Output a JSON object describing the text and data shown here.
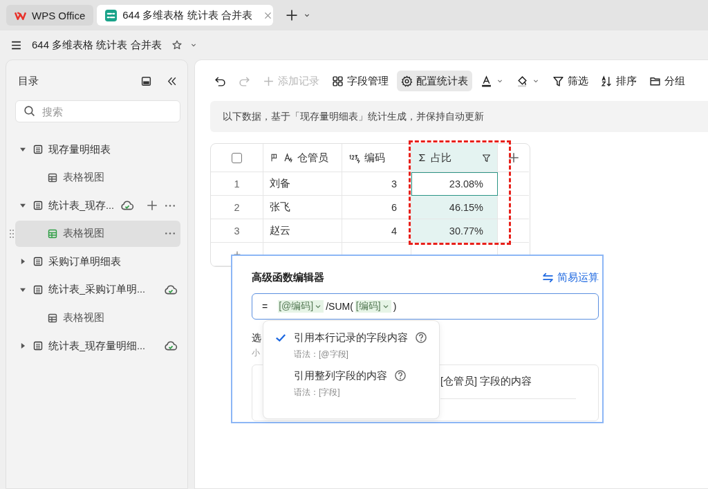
{
  "browser_tabs": [
    {
      "label": "WPS Office",
      "selected": false,
      "closable": false
    },
    {
      "label": "644 多维表格 统计表 合并表",
      "selected": true,
      "closable": true
    }
  ],
  "header": {
    "title": "644 多维表格 统计表 合并表",
    "starred": false
  },
  "sidebar": {
    "title": "目录",
    "search": {
      "placeholder": "搜索"
    },
    "items": [
      {
        "label": "现存量明细表",
        "kind": "table",
        "expanded": true,
        "synced": false,
        "selected": false,
        "actions_visible": false,
        "children": [
          {
            "label": "表格视图",
            "kind": "view",
            "selected": false,
            "actions_visible": false
          }
        ]
      },
      {
        "label": "统计表_现存...",
        "kind": "table",
        "expanded": true,
        "synced": true,
        "selected": false,
        "actions_visible": true,
        "children": [
          {
            "label": "表格视图",
            "kind": "view",
            "selected": true,
            "actions_visible": true
          }
        ]
      },
      {
        "label": "采购订单明细表",
        "kind": "table",
        "expanded": false,
        "synced": false,
        "selected": false,
        "actions_visible": false
      },
      {
        "label": "统计表_采购订单明...",
        "kind": "table",
        "expanded": true,
        "synced": true,
        "selected": false,
        "actions_visible": false,
        "children": [
          {
            "label": "表格视图",
            "kind": "view",
            "selected": false,
            "actions_visible": false
          }
        ]
      },
      {
        "label": "统计表_现存量明细...",
        "kind": "table",
        "expanded": false,
        "synced": true,
        "selected": false,
        "actions_visible": false
      }
    ]
  },
  "toolbar": [
    {
      "kind": "undo",
      "disabled": false,
      "selected": false
    },
    {
      "kind": "redo",
      "disabled": true,
      "selected": false
    },
    {
      "kind": "plus",
      "label": "添加记录",
      "disabled": true,
      "selected": false
    },
    {
      "kind": "grid",
      "label": "字段管理",
      "disabled": false,
      "selected": false
    },
    {
      "kind": "gear",
      "label": "配置统计表",
      "disabled": false,
      "selected": true
    },
    {
      "kind": "text-color",
      "disabled": false,
      "selected": false
    },
    {
      "kind": "fill-color",
      "disabled": false,
      "selected": false
    },
    {
      "kind": "filter",
      "label": "筛选",
      "disabled": false,
      "selected": false
    },
    {
      "kind": "sort",
      "label": "排序",
      "disabled": false,
      "selected": false
    },
    {
      "kind": "folder",
      "label": "分组",
      "disabled": false,
      "selected": false
    }
  ],
  "notice": "以下数据，基于「现存量明细表」统计生成，并保持自动更新",
  "table": {
    "all_checked": false,
    "columns": [
      {
        "label": "仓管员",
        "kind": "text",
        "highlighted": false
      },
      {
        "label": "编码",
        "kind": "number",
        "highlighted": false
      },
      {
        "label": "占比",
        "kind": "sum",
        "highlighted": true
      }
    ],
    "rows": [
      {
        "index": "1",
        "cells": [
          "刘备",
          "3",
          "23.08%"
        ],
        "focused": true
      },
      {
        "index": "2",
        "cells": [
          "张飞",
          "6",
          "46.15%"
        ],
        "focused": false
      },
      {
        "index": "3",
        "cells": [
          "赵云",
          "4",
          "30.77%"
        ],
        "focused": false
      }
    ]
  },
  "formula_editor": {
    "title": "高级函数编辑器",
    "mode_link": "简易运算",
    "formula": [
      {
        "kind": "operator",
        "text": "="
      },
      {
        "kind": "field",
        "text": "[@编码]"
      },
      {
        "kind": "text",
        "text": "/SUM("
      },
      {
        "kind": "field",
        "text": "[编码]"
      },
      {
        "kind": "text",
        "text": ")"
      }
    ],
    "section_label": "选",
    "section_hint": "小",
    "card_text": "[仓管员] 字段的内容",
    "reference_menu": [
      {
        "label": "引用本行记录的字段内容",
        "syntax": "语法：[@字段]",
        "selected": true
      },
      {
        "label": "引用整列字段的内容",
        "syntax": "语法：[字段]",
        "selected": false
      }
    ]
  }
}
